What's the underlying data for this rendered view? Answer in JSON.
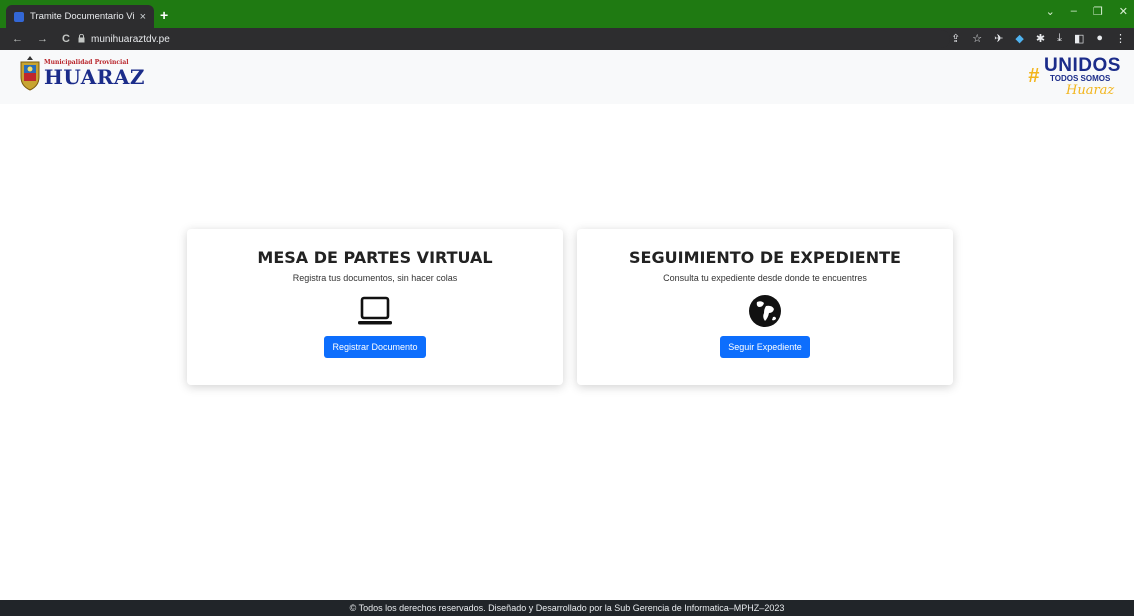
{
  "browser": {
    "tab_title": "Tramite Documentario Virtual",
    "tab_close": "×",
    "new_tab": "+",
    "url": "munihuaraztdv.pe",
    "nav": {
      "back": "←",
      "forward": "→",
      "reload": "C"
    },
    "window_controls": {
      "dropdown": "⌄",
      "minimize": "–",
      "restore": "❐",
      "close": "✕"
    },
    "toolbar_icons": [
      "share-icon",
      "star-icon",
      "extension-icon",
      "extension-icon",
      "puzzle-icon",
      "download-icon",
      "sidepanel-icon",
      "profile-icon",
      "menu-icon"
    ],
    "colors": {
      "tabbar": "#1f7a12",
      "toolbar": "#2d2d2f"
    }
  },
  "header": {
    "logo_small": "Municipalidad Provincial",
    "logo_big": "HUARAZ",
    "slogan_hash": "#",
    "slogan_unidos": "UNIDOS",
    "slogan_todos": "TODOS SOMOS",
    "slogan_huaraz": "Huaraz"
  },
  "cards": [
    {
      "title": "MESA DE PARTES VIRTUAL",
      "subtitle": "Registra tus documentos, sin hacer colas",
      "icon": "laptop-icon",
      "button_label": "Registrar Documento"
    },
    {
      "title": "SEGUIMIENTO DE EXPEDIENTE",
      "subtitle": "Consulta tu expediente desde donde te encuentres",
      "icon": "globe-icon",
      "button_label": "Seguir Expediente"
    }
  ],
  "footer": {
    "text": "© Todos los derechos reservados. Diseñado y Desarrollado por la Sub Gerencia de Informatica–MPHZ–2023"
  },
  "colors": {
    "primary_button": "#0d6efd",
    "brand_blue": "#1b2c8a",
    "brand_yellow": "#f2b51c",
    "footer_bg": "#212529"
  }
}
